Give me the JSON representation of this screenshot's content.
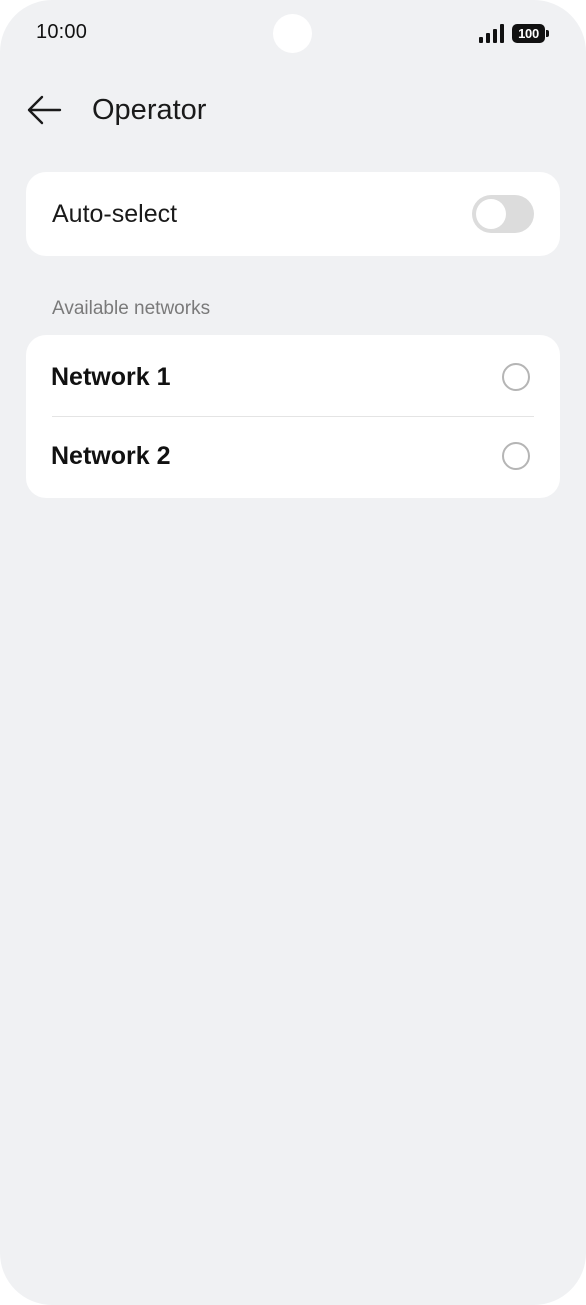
{
  "status_bar": {
    "time": "10:00",
    "battery": "100",
    "signal_icon": "signal-bars-icon",
    "battery_icon": "battery-icon"
  },
  "header": {
    "back_icon": "arrow-left-icon",
    "title": "Operator"
  },
  "auto_select": {
    "label": "Auto-select",
    "enabled": false
  },
  "networks": {
    "section_title": "Available networks",
    "items": [
      {
        "label": "Network 1",
        "selected": false
      },
      {
        "label": "Network 2",
        "selected": false
      }
    ]
  },
  "colors": {
    "background": "#f0f1f3",
    "card": "#ffffff",
    "toggle_off": "#dcdcdc",
    "radio_border": "#b5b5b5"
  }
}
